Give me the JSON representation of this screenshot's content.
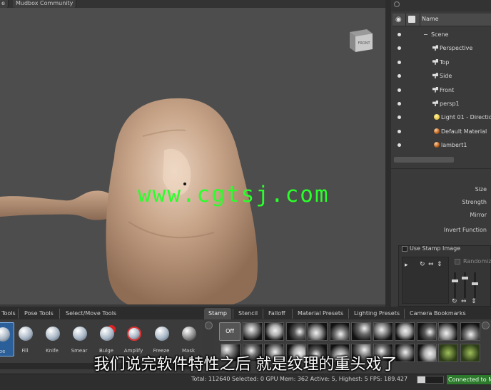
{
  "top_tabs": [
    {
      "label": "e"
    },
    {
      "label": "Mudbox Community"
    }
  ],
  "viewport": {
    "cube_label": "FRONT"
  },
  "object_list": {
    "header_name": "Name",
    "rows": [
      {
        "label": "Scene",
        "icon": "tree-minus-icon"
      },
      {
        "label": "Perspective",
        "icon": "camera-icon"
      },
      {
        "label": "Top",
        "icon": "camera-icon"
      },
      {
        "label": "Side",
        "icon": "camera-icon"
      },
      {
        "label": "Front",
        "icon": "camera-icon"
      },
      {
        "label": "persp1",
        "icon": "camera-icon"
      },
      {
        "label": "Light 01 - Direction",
        "icon": "light-bulb-icon"
      },
      {
        "label": "Default Material",
        "icon": "material-ball-icon"
      },
      {
        "label": "lambert1",
        "icon": "material-ball-icon"
      }
    ]
  },
  "properties": {
    "size_label": "Size",
    "strength_label": "Strength",
    "mirror_label": "Mirror",
    "invert_label": "Invert Function",
    "use_stamp_label": "Use Stamp Image",
    "randomize_label": "Randomize"
  },
  "tool_tabs": [
    {
      "label": "Tools"
    },
    {
      "label": "Pose Tools"
    },
    {
      "label": "Select/Move Tools"
    }
  ],
  "tools": [
    {
      "label": "pe",
      "icon": "sculpt-icon"
    },
    {
      "label": "Fill",
      "icon": "fill-icon"
    },
    {
      "label": "Knife",
      "icon": "knife-icon"
    },
    {
      "label": "Smear",
      "icon": "smear-icon"
    },
    {
      "label": "Bulge",
      "icon": "bulge-icon"
    },
    {
      "label": "Amplify",
      "icon": "amplify-icon"
    },
    {
      "label": "Freeze",
      "icon": "freeze-icon"
    },
    {
      "label": "Mask",
      "icon": "mask-icon"
    }
  ],
  "tray_tabs": [
    {
      "label": "Stamp"
    },
    {
      "label": "Stencil"
    },
    {
      "label": "Falloff"
    },
    {
      "label": "Material Presets"
    },
    {
      "label": "Lighting Presets"
    },
    {
      "label": "Camera Bookmarks"
    }
  ],
  "stamp_off_label": "Off",
  "watermark": "www.cgtsj.com",
  "subtitle": "我们说完软件特性之后 就是纹理的重头戏了",
  "status": {
    "text": "Total: 112640  Selected: 0  GPU Mem: 362  Active: 5, Highest: 5  FPS: 189.427",
    "progress": 0.3,
    "connected": "Connected to Ma"
  }
}
